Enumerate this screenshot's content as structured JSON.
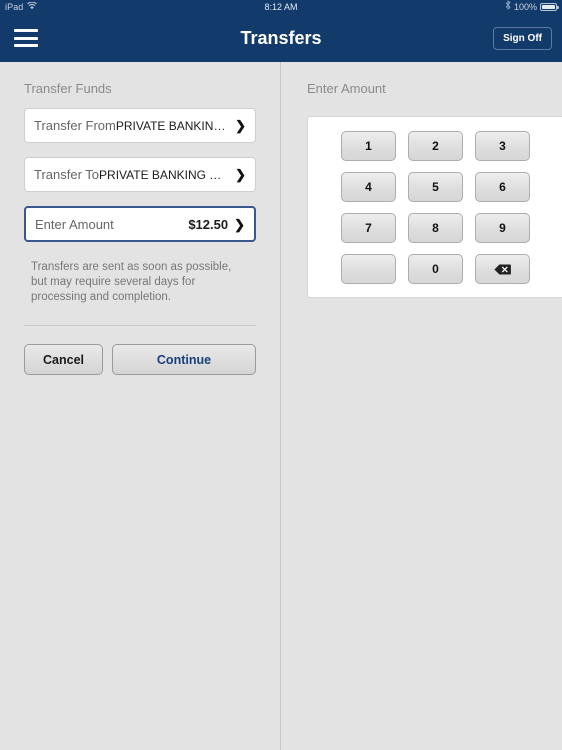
{
  "statusbar": {
    "device": "iPad",
    "wifi_icon": "wifi-icon",
    "time": "8:12 AM",
    "bluetooth_icon": "bluetooth-icon",
    "battery_percent": "100%"
  },
  "navbar": {
    "menu_icon": "hamburger-menu-icon",
    "title": "Transfers",
    "sign_off_label": "Sign Off"
  },
  "left_pane": {
    "section_title": "Transfer Funds",
    "fields": [
      {
        "label": "Transfer From",
        "value": "PRIVATE BANKING NO...",
        "chevron": "❯",
        "focused": false
      },
      {
        "label": "Transfer To",
        "value": "PRIVATE BANKING NO...",
        "chevron": "❯",
        "focused": false
      },
      {
        "label": "Enter Amount",
        "value": "$12.50",
        "chevron": "❯",
        "focused": true
      }
    ],
    "disclaimer": "Transfers are sent as soon as possible, but may require several days for processing and completion.",
    "cancel_label": "Cancel",
    "continue_label": "Continue"
  },
  "right_pane": {
    "section_title": "Enter Amount",
    "keypad": [
      {
        "label": "1",
        "name": "key-1"
      },
      {
        "label": "2",
        "name": "key-2"
      },
      {
        "label": "3",
        "name": "key-3"
      },
      {
        "label": "4",
        "name": "key-4"
      },
      {
        "label": "5",
        "name": "key-5"
      },
      {
        "label": "6",
        "name": "key-6"
      },
      {
        "label": "7",
        "name": "key-7"
      },
      {
        "label": "8",
        "name": "key-8"
      },
      {
        "label": "9",
        "name": "key-9"
      },
      {
        "label": "",
        "name": "key-blank"
      },
      {
        "label": "0",
        "name": "key-0"
      },
      {
        "label": "",
        "name": "key-backspace",
        "icon": "backspace-icon"
      }
    ]
  },
  "colors": {
    "navy": "#123a6b",
    "panel_bg": "#e3e3e3",
    "focus_border": "#39588c",
    "continue_text": "#17417c"
  }
}
